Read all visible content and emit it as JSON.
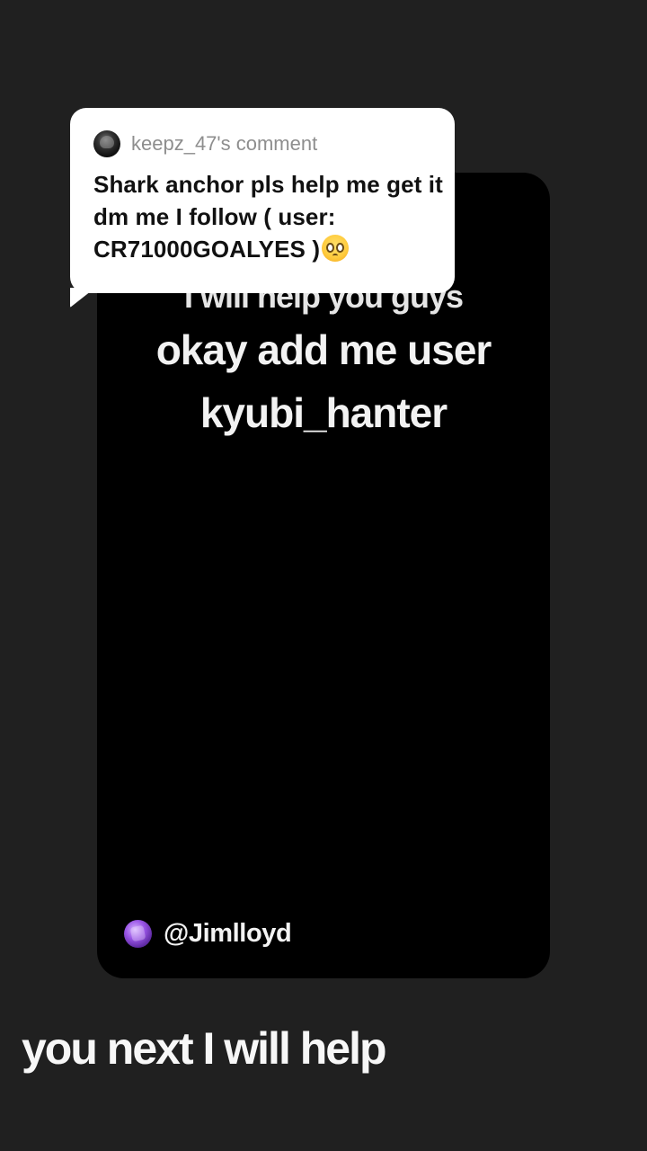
{
  "comment": {
    "username": "keepz_47's comment",
    "text": "Shark anchor pls help me get it dm me I follow ( user: CR71000GOALYES )",
    "emoji_icon": "pleading-face-emoji"
  },
  "video": {
    "partial_line": "I will help you guys",
    "line_1": "okay add me user",
    "line_2": "kyubi_hanter",
    "credit_handle": "@Jimlloyd"
  },
  "caption": {
    "text": "you next I will help"
  }
}
